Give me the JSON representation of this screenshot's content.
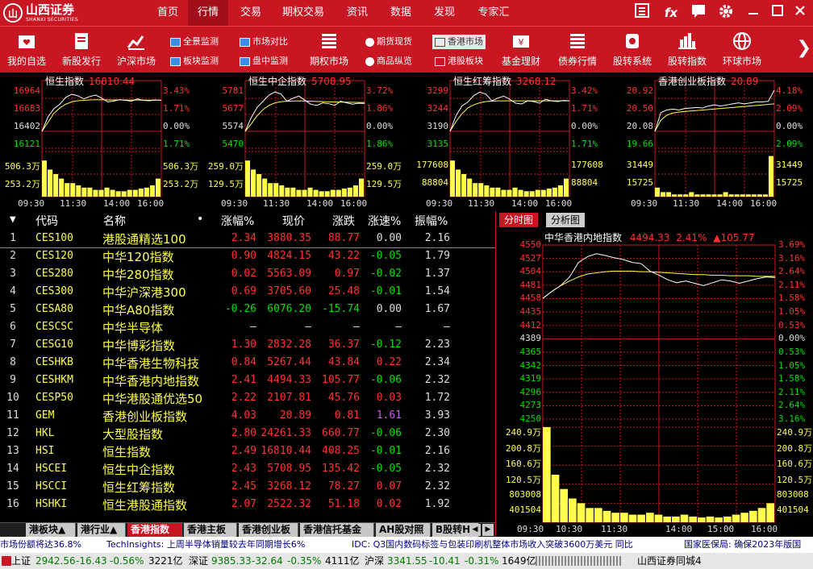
{
  "app": {
    "logo_cn": "山西证券",
    "logo_en": "SHANXI SECURITIES",
    "logo_mark": "山"
  },
  "nav": [
    {
      "label": "首页",
      "active": false
    },
    {
      "label": "行情",
      "active": true
    },
    {
      "label": "交易",
      "active": false
    },
    {
      "label": "期权交易",
      "active": false
    },
    {
      "label": "资讯",
      "active": false
    },
    {
      "label": "数据",
      "active": false
    },
    {
      "label": "发现",
      "active": false
    },
    {
      "label": "专家汇",
      "active": false
    }
  ],
  "window_controls": {
    "fx": "fx"
  },
  "toolbar": {
    "big": [
      {
        "label": "我的自选",
        "icon": "heart-folder-icon"
      },
      {
        "label": "新股发行",
        "icon": "document-icon"
      },
      {
        "label": "沪深市场",
        "icon": "line-chart-icon"
      },
      {
        "label": "期权市场",
        "icon": "list-icon"
      },
      {
        "label": "基金理财",
        "icon": "yen-card-icon"
      },
      {
        "label": "债券行情",
        "icon": "list-icon"
      },
      {
        "label": "股转系统",
        "icon": "money-icon"
      },
      {
        "label": "股转指数",
        "icon": "bar-chart-icon"
      },
      {
        "label": "环球市场",
        "icon": "globe-icon"
      }
    ],
    "small": [
      {
        "label": "全景监测",
        "icon": "monitor-icon"
      },
      {
        "label": "板块监测",
        "icon": "monitor-icon"
      },
      {
        "label": "市场对比",
        "icon": "monitor-icon"
      },
      {
        "label": "盘中监测",
        "icon": "monitor-icon"
      },
      {
        "label": "期货现货",
        "icon": "coins-icon"
      },
      {
        "label": "商品纵览",
        "icon": "coins-icon"
      },
      {
        "label": "香港市场",
        "icon": "square-icon"
      },
      {
        "label": "港股板块",
        "icon": "square-icon"
      }
    ]
  },
  "mini_charts": [
    {
      "name": "恒生指数",
      "value": "16810.44",
      "left_labels": [
        "16964",
        "16683",
        "16402",
        "16121",
        "506.3万",
        "253.2万"
      ],
      "right_labels": [
        "3.43%",
        "1.71%",
        "0.00%",
        "1.71%",
        "506.3万",
        "253.2万"
      ],
      "time_labels": [
        "09:30",
        "11:30",
        "14:00",
        "16:00"
      ],
      "price_series": [
        16402,
        16590,
        16700,
        16760,
        16850,
        16890,
        16870,
        16830,
        16860,
        16880,
        16840,
        16790,
        16800,
        16820,
        16810,
        16800,
        16830,
        16810,
        16805,
        16815,
        16810
      ],
      "avg_series": [
        16402,
        16520,
        16640,
        16710,
        16760,
        16790,
        16805,
        16810,
        16815,
        16818,
        16818,
        16816,
        16815,
        16815,
        16814,
        16814,
        16814,
        16813,
        16813,
        16813,
        16813
      ],
      "volume": [
        0.8,
        0.6,
        0.5,
        0.4,
        0.3,
        0.3,
        0.25,
        0.2,
        0.2,
        0.15,
        0.15,
        0.2,
        0.15,
        0.12,
        0.12,
        0.15,
        0.15,
        0.18,
        0.2,
        0.25,
        0.4
      ]
    },
    {
      "name": "恒生中企指数",
      "value": "5708.95",
      "left_labels": [
        "5781",
        "5677",
        "5574",
        "5470",
        "259.0万",
        "129.5万"
      ],
      "right_labels": [
        "3.72%",
        "1.86%",
        "0.00%",
        "1.86%",
        "259.0万",
        "129.5万"
      ],
      "time_labels": [
        "09:30",
        "11:30",
        "14:00",
        "16:00"
      ],
      "price_series": [
        5574,
        5640,
        5690,
        5720,
        5750,
        5765,
        5755,
        5720,
        5735,
        5745,
        5725,
        5705,
        5700,
        5712,
        5708,
        5700,
        5720,
        5712,
        5706,
        5710,
        5709
      ],
      "avg_series": [
        5574,
        5610,
        5650,
        5680,
        5700,
        5712,
        5718,
        5720,
        5721,
        5722,
        5721,
        5720,
        5719,
        5718,
        5717,
        5716,
        5716,
        5715,
        5715,
        5714,
        5714
      ],
      "volume": [
        0.8,
        0.6,
        0.5,
        0.4,
        0.3,
        0.3,
        0.25,
        0.2,
        0.2,
        0.15,
        0.15,
        0.2,
        0.15,
        0.12,
        0.12,
        0.15,
        0.15,
        0.18,
        0.2,
        0.25,
        0.4
      ]
    },
    {
      "name": "恒生红筹指数",
      "value": "3268.12",
      "left_labels": [
        "3299",
        "3244",
        "3190",
        "3135",
        "177608",
        "88804"
      ],
      "right_labels": [
        "3.42%",
        "1.71%",
        "0.00%",
        "1.71%",
        "177608",
        "88804"
      ],
      "time_labels": [
        "09:30",
        "11:30",
        "14:00",
        "16:00"
      ],
      "price_series": [
        3190,
        3230,
        3255,
        3265,
        3282,
        3290,
        3285,
        3268,
        3275,
        3280,
        3272,
        3262,
        3260,
        3268,
        3266,
        3262,
        3272,
        3268,
        3266,
        3269,
        3268
      ],
      "avg_series": [
        3190,
        3215,
        3235,
        3250,
        3258,
        3263,
        3266,
        3267,
        3268,
        3268,
        3268,
        3268,
        3268,
        3268,
        3268,
        3268,
        3268,
        3268,
        3268,
        3268,
        3268
      ],
      "volume": [
        0.8,
        0.6,
        0.5,
        0.4,
        0.3,
        0.3,
        0.25,
        0.2,
        0.2,
        0.15,
        0.15,
        0.2,
        0.15,
        0.12,
        0.12,
        0.15,
        0.15,
        0.18,
        0.2,
        0.25,
        0.4
      ]
    },
    {
      "name": "香港创业板指数",
      "value": "20.89",
      "left_labels": [
        "20.92",
        "20.50",
        "20.08",
        "19.66",
        "31449",
        "15725"
      ],
      "right_labels": [
        "4.18%",
        "2.09%",
        "0.00%",
        "2.09%",
        "31449",
        "15725"
      ],
      "time_labels": [
        "09:30",
        "11:30",
        "14:00",
        "16:00"
      ],
      "price_series": [
        20.08,
        20.45,
        20.5,
        20.52,
        20.5,
        20.53,
        20.54,
        20.55,
        20.54,
        20.58,
        20.6,
        20.58,
        20.6,
        20.62,
        20.64,
        20.62,
        20.64,
        20.66,
        20.66,
        20.67,
        20.89
      ],
      "avg_series": [
        20.08,
        20.3,
        20.4,
        20.44,
        20.46,
        20.47,
        20.48,
        20.49,
        20.5,
        20.51,
        20.52,
        20.53,
        20.54,
        20.55,
        20.56,
        20.57,
        20.58,
        20.59,
        20.6,
        20.61,
        20.62
      ],
      "volume": [
        0.2,
        0.1,
        0.1,
        0.05,
        0.05,
        0.05,
        0.1,
        0.05,
        0.05,
        0.05,
        0.05,
        0.05,
        0.1,
        0.05,
        0.05,
        0.05,
        0.05,
        0.05,
        0.05,
        0.05,
        0.9
      ]
    }
  ],
  "table": {
    "headers": [
      "代码",
      "名称",
      "•",
      "涨幅%",
      "现价",
      "涨跌",
      "涨速%",
      "振幅%"
    ],
    "rows": [
      {
        "idx": "1",
        "code": "CES100",
        "name": "港股通精选100",
        "pct": "2.34",
        "price": "3880.35",
        "chg": "88.77",
        "speed": "0.00",
        "amp": "2.16"
      },
      {
        "idx": "2",
        "code": "CES120",
        "name": "中华120指数",
        "pct": "0.90",
        "price": "4824.15",
        "chg": "43.22",
        "speed": "-0.05",
        "amp": "1.79"
      },
      {
        "idx": "3",
        "code": "CES280",
        "name": "中华280指数",
        "pct": "0.02",
        "price": "5563.09",
        "chg": "0.97",
        "speed": "-0.02",
        "amp": "1.37"
      },
      {
        "idx": "4",
        "code": "CES300",
        "name": "中华沪深港300",
        "pct": "0.69",
        "price": "3705.60",
        "chg": "25.48",
        "speed": "-0.01",
        "amp": "1.54"
      },
      {
        "idx": "5",
        "code": "CESA80",
        "name": "中华A80指数",
        "pct": "-0.26",
        "price": "6076.20",
        "chg": "-15.74",
        "speed": "0.00",
        "amp": "1.67"
      },
      {
        "idx": "6",
        "code": "CESCSC",
        "name": "中华半导体",
        "pct": "–",
        "price": "–",
        "chg": "–",
        "speed": "–",
        "amp": "–"
      },
      {
        "idx": "7",
        "code": "CESG10",
        "name": "中华博彩指数",
        "pct": "1.30",
        "price": "2832.28",
        "chg": "36.37",
        "speed": "-0.12",
        "amp": "2.23"
      },
      {
        "idx": "8",
        "code": "CESHKB",
        "name": "中华香港生物科技",
        "pct": "0.84",
        "price": "5267.44",
        "chg": "43.84",
        "speed": "0.22",
        "amp": "2.34"
      },
      {
        "idx": "9",
        "code": "CESHKM",
        "name": "中华香港内地指数",
        "pct": "2.41",
        "price": "4494.33",
        "chg": "105.77",
        "speed": "-0.06",
        "amp": "2.32"
      },
      {
        "idx": "10",
        "code": "CESP50",
        "name": "中华港股通优选50",
        "pct": "2.22",
        "price": "2107.81",
        "chg": "45.76",
        "speed": "0.03",
        "amp": "1.72"
      },
      {
        "idx": "11",
        "code": "GEM",
        "name": "香港创业板指数",
        "pct": "4.03",
        "price": "20.89",
        "chg": "0.81",
        "speed": "1.61",
        "amp": "3.93"
      },
      {
        "idx": "12",
        "code": "HKL",
        "name": "大型股指数",
        "pct": "2.80",
        "price": "24261.33",
        "chg": "660.77",
        "speed": "-0.06",
        "amp": "2.30"
      },
      {
        "idx": "13",
        "code": "HSI",
        "name": "恒生指数",
        "pct": "2.49",
        "price": "16810.44",
        "chg": "408.25",
        "speed": "-0.01",
        "amp": "2.16"
      },
      {
        "idx": "14",
        "code": "HSCEI",
        "name": "恒生中企指数",
        "pct": "2.43",
        "price": "5708.95",
        "chg": "135.42",
        "speed": "-0.05",
        "amp": "2.32"
      },
      {
        "idx": "15",
        "code": "HSCCI",
        "name": "恒生红筹指数",
        "pct": "2.45",
        "price": "3268.12",
        "chg": "78.27",
        "speed": "0.07",
        "amp": "2.32"
      },
      {
        "idx": "16",
        "code": "HSHKI",
        "name": "恒生港股通指数",
        "pct": "2.07",
        "price": "2522.32",
        "chg": "51.18",
        "speed": "0.02",
        "amp": "1.92"
      }
    ]
  },
  "sheet_tabs": [
    {
      "label": "港板块▲",
      "active": false
    },
    {
      "label": "港行业▲",
      "active": false
    },
    {
      "label": "香港指数",
      "active": true
    },
    {
      "label": "香港主板",
      "active": false
    },
    {
      "label": "香港创业板",
      "active": false
    },
    {
      "label": "香港信托基金",
      "active": false
    },
    {
      "label": "AH股对照",
      "active": false
    },
    {
      "label": "B股转H股",
      "active": false
    }
  ],
  "sheet_ctrls": {
    "prev": "◀",
    "next": "▶"
  },
  "detail_chart": {
    "tabs": [
      "分时图",
      "分析图"
    ],
    "title_name": "中华香港内地指数",
    "title_price": "4494.33",
    "title_pct": "2.41%",
    "title_chg": "▲105.77",
    "left_labels": [
      "4550",
      "4527",
      "4504",
      "4481",
      "4458",
      "4435",
      "4412",
      "4389",
      "4365",
      "4342",
      "4319",
      "4296",
      "4273",
      "4250"
    ],
    "right_labels": [
      "3.69%",
      "3.16%",
      "2.64%",
      "2.11%",
      "1.58%",
      "1.05%",
      "0.53%",
      "0.00%",
      "0.53%",
      "1.05%",
      "1.58%",
      "2.11%",
      "2.64%",
      "3.16%"
    ],
    "vol_left_labels": [
      "240.9万",
      "200.8万",
      "160.6万",
      "120.5万",
      "803008",
      "401504"
    ],
    "vol_right_labels": [
      "240.9万",
      "200.8万",
      "160.6万",
      "120.5万",
      "803008",
      "401504"
    ],
    "time_labels": [
      "09:30",
      "10:30",
      "11:30",
      "14:00",
      "15:00",
      "16:00"
    ],
    "price_series": [
      4458,
      4470,
      4480,
      4495,
      4520,
      4530,
      4535,
      4532,
      4528,
      4525,
      4520,
      4518,
      4505,
      4498,
      4490,
      4485,
      4488,
      4484,
      4480,
      4485,
      4490,
      4488,
      4484,
      4488,
      4492,
      4495,
      4494
    ],
    "avg_series": [
      4458,
      4470,
      4480,
      4488,
      4495,
      4500,
      4502,
      4504,
      4505,
      4505,
      4505,
      4504,
      4504,
      4503,
      4502,
      4501,
      4500,
      4499,
      4499,
      4498,
      4498,
      4497,
      4497,
      4497,
      4496,
      4496,
      4496
    ],
    "volume": [
      1.0,
      0.5,
      0.35,
      0.25,
      0.2,
      0.15,
      0.15,
      0.12,
      0.1,
      0.1,
      0.08,
      0.08,
      0.1,
      0.08,
      0.06,
      0.06,
      0.08,
      0.06,
      0.05,
      0.06,
      0.05,
      0.06,
      0.08,
      0.1,
      0.12,
      0.15,
      0.2
    ]
  },
  "ticker": [
    "市场份额将达36.8%",
    "TechInsights: 上周半导体销量较去年同期增长6%",
    "IDC: Q3国内数码标签与包装印刷机整体市场收入突破3600万美元 同比",
    "国家医保局: 确保2023年版国"
  ],
  "status": {
    "sh_label": "上证",
    "sh_val": "2942.56",
    "sh_chg": "-16.43",
    "sh_pct": "-0.56%",
    "sh_amt": "3221亿",
    "sz_label": "深证",
    "sz_val": "9385.33",
    "sz_chg": "-32.64",
    "sz_pct": "-0.35%",
    "sz_amt": "4111亿",
    "hs_label": "沪深",
    "hs_val": "3341.55",
    "hs_chg": "-10.41",
    "hs_pct": "-0.31%",
    "hs_amt": "1649亿",
    "server": "山西证券同城4"
  }
}
